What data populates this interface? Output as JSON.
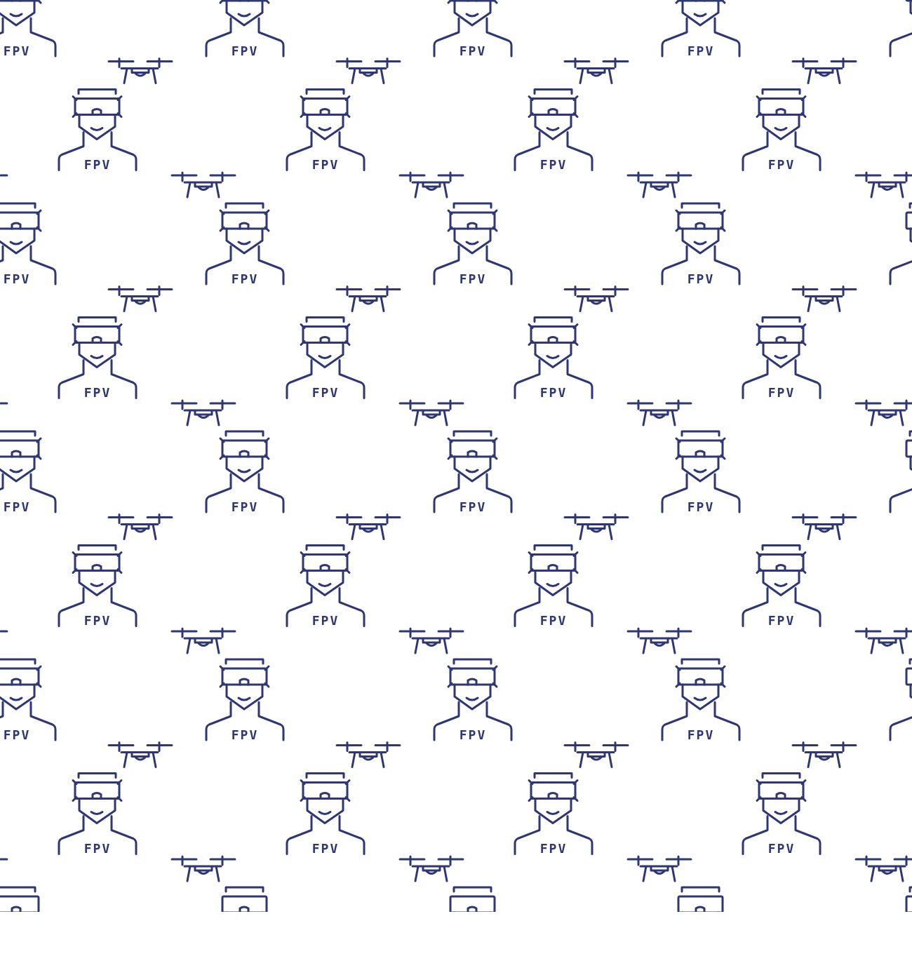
{
  "pattern": {
    "rows": [
      {
        "figures": [
          {
            "label": "FPV"
          },
          {
            "label": "FPV"
          },
          {
            "label": "FPV"
          },
          {
            "label": "FPV"
          }
        ]
      },
      {
        "figures": [
          {
            "label": "FPV"
          },
          {
            "label": "FPV"
          },
          {
            "label": "FPV"
          },
          {
            "label": "FPV"
          }
        ]
      },
      {
        "figures": [
          {
            "label": "FPV"
          },
          {
            "label": "FPV"
          },
          {
            "label": "FPV"
          },
          {
            "label": "FPV"
          }
        ]
      },
      {
        "figures": [
          {
            "label": "FPV"
          },
          {
            "label": "FPV"
          },
          {
            "label": "FPV"
          },
          {
            "label": "FPV"
          }
        ]
      },
      {
        "figures": [
          {
            "label": "FPV"
          },
          {
            "label": "FPV"
          },
          {
            "label": "FPV"
          },
          {
            "label": "FPV"
          }
        ]
      },
      {
        "figures": [
          {
            "label": "FPV"
          },
          {
            "label": "FPV"
          },
          {
            "label": "FPV"
          },
          {
            "label": "FPV"
          }
        ]
      },
      {
        "figures": [
          {
            "label": "FPV"
          },
          {
            "label": "FPV"
          },
          {
            "label": "FPV"
          },
          {
            "label": "FPV"
          }
        ]
      },
      {
        "figures": [
          {
            "label": "FPV"
          },
          {
            "label": "FPV"
          },
          {
            "label": "FPV"
          },
          {
            "label": "FPV"
          }
        ]
      }
    ]
  }
}
